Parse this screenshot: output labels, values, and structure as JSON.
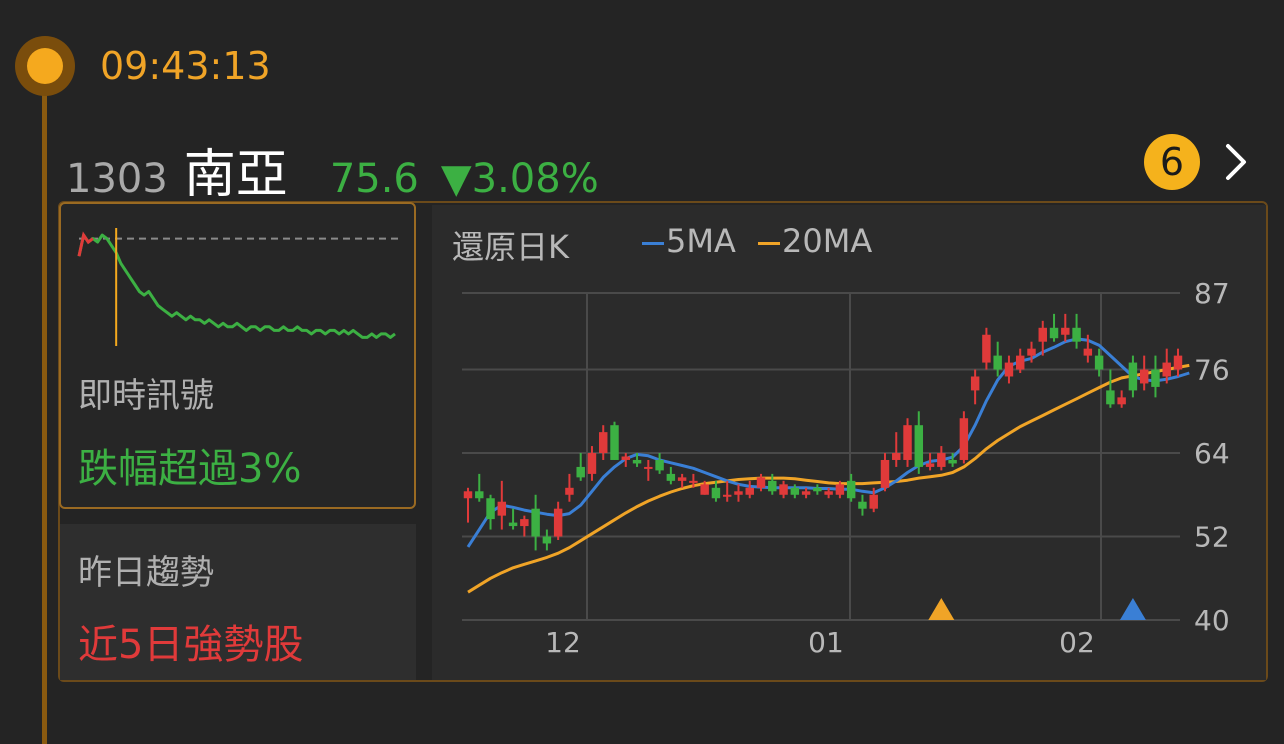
{
  "header": {
    "time": "09:43:13"
  },
  "stock": {
    "code": "1303",
    "name": "南亞",
    "price": "75.6",
    "change": "▼3.08%",
    "notification_count": "6"
  },
  "signal": {
    "label": "即時訊號",
    "value": "跌幅超過3%"
  },
  "trend": {
    "label": "昨日趨勢",
    "value": "近5日強勢股"
  },
  "kchart": {
    "title": "還原日K",
    "legend_5ma": "5MA",
    "legend_20ma": "20MA"
  },
  "colors": {
    "up": "#e03a3a",
    "down": "#3cb043",
    "ma5": "#3a7fd5",
    "ma20": "#f0a427",
    "accent": "#f5a91e",
    "grid": "#4a4a4a"
  },
  "chart_data": [
    {
      "type": "line",
      "title": "",
      "series": [
        {
          "values": [
            78,
            84,
            82,
            83,
            82,
            84,
            83,
            81,
            79,
            76,
            74,
            72,
            70,
            68,
            67,
            68,
            66,
            64,
            63,
            62,
            61,
            62,
            61,
            60,
            61,
            60,
            60,
            59,
            60,
            59,
            58,
            59,
            58,
            58,
            59,
            58,
            57,
            58,
            58,
            57,
            58,
            58,
            57,
            57,
            58,
            57,
            57,
            58,
            57,
            57,
            56,
            57,
            57,
            56,
            57,
            57,
            56,
            57,
            56,
            57,
            56,
            55,
            55,
            56,
            55,
            56,
            56,
            55,
            56
          ]
        }
      ],
      "reference_value": 83
    },
    {
      "type": "candlestick",
      "title": "還原日K",
      "x_ticks": [
        "12",
        "01",
        "02"
      ],
      "y_ticks": [
        40,
        52,
        64,
        76,
        87
      ],
      "ylim": [
        40,
        87
      ],
      "candles": [
        {
          "o": 57.5,
          "h": 59,
          "l": 54,
          "c": 58.5
        },
        {
          "o": 58.5,
          "h": 61,
          "l": 57,
          "c": 57.5
        },
        {
          "o": 57.5,
          "h": 58,
          "l": 53,
          "c": 54.5
        },
        {
          "o": 55,
          "h": 60,
          "l": 53,
          "c": 57
        },
        {
          "o": 54,
          "h": 56,
          "l": 53,
          "c": 53.5
        },
        {
          "o": 53.5,
          "h": 55,
          "l": 52,
          "c": 54.5
        },
        {
          "o": 56,
          "h": 58,
          "l": 50,
          "c": 52
        },
        {
          "o": 52,
          "h": 53,
          "l": 50,
          "c": 51
        },
        {
          "o": 52,
          "h": 57,
          "l": 51.5,
          "c": 56
        },
        {
          "o": 58,
          "h": 61,
          "l": 57,
          "c": 59
        },
        {
          "o": 62,
          "h": 64,
          "l": 60,
          "c": 60.5
        },
        {
          "o": 61,
          "h": 65,
          "l": 60,
          "c": 64
        },
        {
          "o": 64,
          "h": 68,
          "l": 63,
          "c": 67
        },
        {
          "o": 68,
          "h": 68.5,
          "l": 63,
          "c": 63
        },
        {
          "o": 63,
          "h": 64,
          "l": 62,
          "c": 63.5
        },
        {
          "o": 63,
          "h": 64,
          "l": 62,
          "c": 62.5
        },
        {
          "o": 62,
          "h": 63,
          "l": 60,
          "c": 62
        },
        {
          "o": 63,
          "h": 64,
          "l": 61,
          "c": 61.5
        },
        {
          "o": 61,
          "h": 62,
          "l": 59.5,
          "c": 60
        },
        {
          "o": 60,
          "h": 61,
          "l": 59,
          "c": 60.5
        },
        {
          "o": 60,
          "h": 61,
          "l": 59,
          "c": 60
        },
        {
          "o": 58,
          "h": 60,
          "l": 58,
          "c": 59.5
        },
        {
          "o": 59,
          "h": 60,
          "l": 57,
          "c": 57.5
        },
        {
          "o": 58,
          "h": 60,
          "l": 57,
          "c": 58
        },
        {
          "o": 58,
          "h": 59.5,
          "l": 57,
          "c": 58.5
        },
        {
          "o": 58,
          "h": 60,
          "l": 57.5,
          "c": 59
        },
        {
          "o": 59,
          "h": 61,
          "l": 58.5,
          "c": 60.5
        },
        {
          "o": 60,
          "h": 61,
          "l": 58,
          "c": 58.5
        },
        {
          "o": 58,
          "h": 60,
          "l": 57.5,
          "c": 59.5
        },
        {
          "o": 59,
          "h": 59.5,
          "l": 57.5,
          "c": 58
        },
        {
          "o": 58,
          "h": 59,
          "l": 57.5,
          "c": 58.5
        },
        {
          "o": 59,
          "h": 59.5,
          "l": 58,
          "c": 58.5
        },
        {
          "o": 58,
          "h": 59,
          "l": 57.5,
          "c": 58.5
        },
        {
          "o": 58,
          "h": 60,
          "l": 57.5,
          "c": 59.5
        },
        {
          "o": 60,
          "h": 61,
          "l": 57,
          "c": 57.5
        },
        {
          "o": 57,
          "h": 58,
          "l": 55,
          "c": 56
        },
        {
          "o": 56,
          "h": 59,
          "l": 55.5,
          "c": 58
        },
        {
          "o": 59,
          "h": 64,
          "l": 58.5,
          "c": 63
        },
        {
          "o": 63,
          "h": 67,
          "l": 62,
          "c": 64
        },
        {
          "o": 63,
          "h": 69,
          "l": 62,
          "c": 68
        },
        {
          "o": 68,
          "h": 70,
          "l": 61,
          "c": 62
        },
        {
          "o": 62,
          "h": 64,
          "l": 61.5,
          "c": 62.5
        },
        {
          "o": 62,
          "h": 65,
          "l": 61.5,
          "c": 64
        },
        {
          "o": 63,
          "h": 64,
          "l": 62,
          "c": 62.5
        },
        {
          "o": 63,
          "h": 70,
          "l": 62.5,
          "c": 69
        },
        {
          "o": 73,
          "h": 76,
          "l": 71,
          "c": 75
        },
        {
          "o": 77,
          "h": 82,
          "l": 76,
          "c": 81
        },
        {
          "o": 78,
          "h": 80,
          "l": 75,
          "c": 76
        },
        {
          "o": 75,
          "h": 78,
          "l": 74,
          "c": 77
        },
        {
          "o": 76,
          "h": 79,
          "l": 75.5,
          "c": 78
        },
        {
          "o": 78,
          "h": 80,
          "l": 77,
          "c": 79
        },
        {
          "o": 80,
          "h": 83,
          "l": 78,
          "c": 82
        },
        {
          "o": 82,
          "h": 84,
          "l": 80,
          "c": 80.5
        },
        {
          "o": 81,
          "h": 84,
          "l": 80,
          "c": 82
        },
        {
          "o": 82,
          "h": 84,
          "l": 79,
          "c": 80
        },
        {
          "o": 78,
          "h": 81,
          "l": 77,
          "c": 79
        },
        {
          "o": 78,
          "h": 79,
          "l": 75,
          "c": 76
        },
        {
          "o": 73,
          "h": 76,
          "l": 70.5,
          "c": 71
        },
        {
          "o": 71,
          "h": 73,
          "l": 70.5,
          "c": 72
        },
        {
          "o": 77,
          "h": 78,
          "l": 72,
          "c": 73
        },
        {
          "o": 74,
          "h": 78,
          "l": 73,
          "c": 76
        },
        {
          "o": 76,
          "h": 78,
          "l": 72,
          "c": 73.5
        },
        {
          "o": 75,
          "h": 79,
          "l": 74,
          "c": 77
        },
        {
          "o": 76,
          "h": 79,
          "l": 75,
          "c": 78
        }
      ],
      "ma5": [
        50.5,
        53,
        55.5,
        56.5,
        56.2,
        55.8,
        55.5,
        55.2,
        55,
        55.3,
        56.5,
        58.5,
        60.5,
        62,
        63.2,
        63.8,
        63.6,
        63,
        62.6,
        62.2,
        61.8,
        61.2,
        60.6,
        60,
        59.5,
        59.2,
        59.1,
        59,
        59,
        59,
        59,
        58.9,
        58.9,
        58.8,
        58.8,
        58.5,
        58.3,
        59,
        60,
        61.2,
        62.2,
        62.8,
        63,
        63.4,
        65,
        68,
        71.5,
        74.5,
        76.5,
        77.2,
        77.6,
        78.5,
        79.2,
        80,
        80.4,
        80.2,
        79.5,
        78,
        76.5,
        75,
        74.5,
        74.4,
        74.6,
        75,
        75.5
      ],
      "ma20": [
        44,
        45,
        46,
        46.8,
        47.5,
        48,
        48.5,
        49,
        49.6,
        50.4,
        51.4,
        52.4,
        53.4,
        54.4,
        55.4,
        56.3,
        57.1,
        57.8,
        58.4,
        58.9,
        59.3,
        59.6,
        59.8,
        60,
        60.2,
        60.3,
        60.4,
        60.4,
        60.4,
        60.3,
        60.1,
        59.9,
        59.7,
        59.6,
        59.6,
        59.6,
        59.7,
        59.8,
        59.9,
        60.1,
        60.4,
        60.6,
        60.8,
        61.2,
        62,
        63.2,
        64.6,
        65.8,
        66.8,
        67.8,
        68.6,
        69.4,
        70.2,
        71,
        71.8,
        72.6,
        73.4,
        74.2,
        74.8,
        75.1,
        75.4,
        75.7,
        76,
        76.3,
        76.6
      ],
      "markers": [
        {
          "type": "triangle",
          "color": "#f0a427",
          "index": 42
        },
        {
          "type": "triangle",
          "color": "#3a7fd5",
          "index": 59
        }
      ]
    }
  ]
}
